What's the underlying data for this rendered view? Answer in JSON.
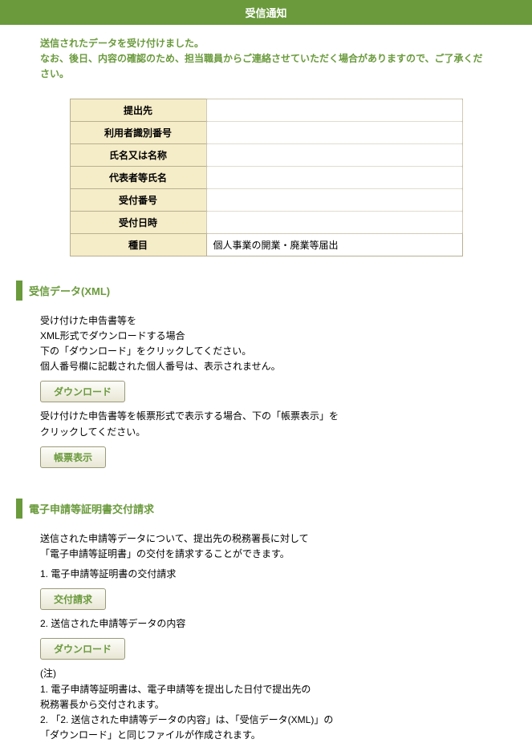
{
  "header": {
    "title": "受信通知"
  },
  "intro": {
    "line1": "送信されたデータを受け付けました。",
    "line2": "なお、後日、内容の確認のため、担当職員からご連絡させていただく場合がありますので、ご了承ください。"
  },
  "table": {
    "rows": [
      {
        "label": "提出先",
        "value": ""
      },
      {
        "label": "利用者識別番号",
        "value": ""
      },
      {
        "label": "氏名又は名称",
        "value": ""
      },
      {
        "label": "代表者等氏名",
        "value": ""
      },
      {
        "label": "受付番号",
        "value": ""
      },
      {
        "label": "受付日時",
        "value": ""
      },
      {
        "label": "種目",
        "value": "個人事業の開業・廃業等届出"
      }
    ]
  },
  "section_xml": {
    "title": "受信データ(XML)",
    "text1_line1": "受け付けた申告書等を",
    "text1_line2": "XML形式でダウンロードする場合",
    "text1_line3": "下の「ダウンロード」をクリックしてください。",
    "text1_line4": "個人番号欄に記載された個人番号は、表示されません。",
    "download_btn": "ダウンロード",
    "text2_line1": "受け付けた申告書等を帳票形式で表示する場合、下の「帳票表示」を",
    "text2_line2": "クリックしてください。",
    "display_btn": "帳票表示"
  },
  "section_cert": {
    "title": "電子申請等証明書交付請求",
    "text1_line1": "送信された申請等データについて、提出先の税務署長に対して",
    "text1_line2": "「電子申請等証明書」の交付を請求することができます。",
    "item1": "1. 電子申請等証明書の交付請求",
    "request_btn": "交付請求",
    "item2": "2. 送信された申請等データの内容",
    "download_btn": "ダウンロード",
    "note_head": "(注)",
    "note1_line1": "1. 電子申請等証明書は、電子申請等を提出した日付で提出先の",
    "note1_line2": "税務署長から交付されます。",
    "note2_line1": "2. 「2. 送信された申請等データの内容」は、「受信データ(XML)」の",
    "note2_line2": "「ダウンロード」と同じファイルが作成されます。"
  }
}
